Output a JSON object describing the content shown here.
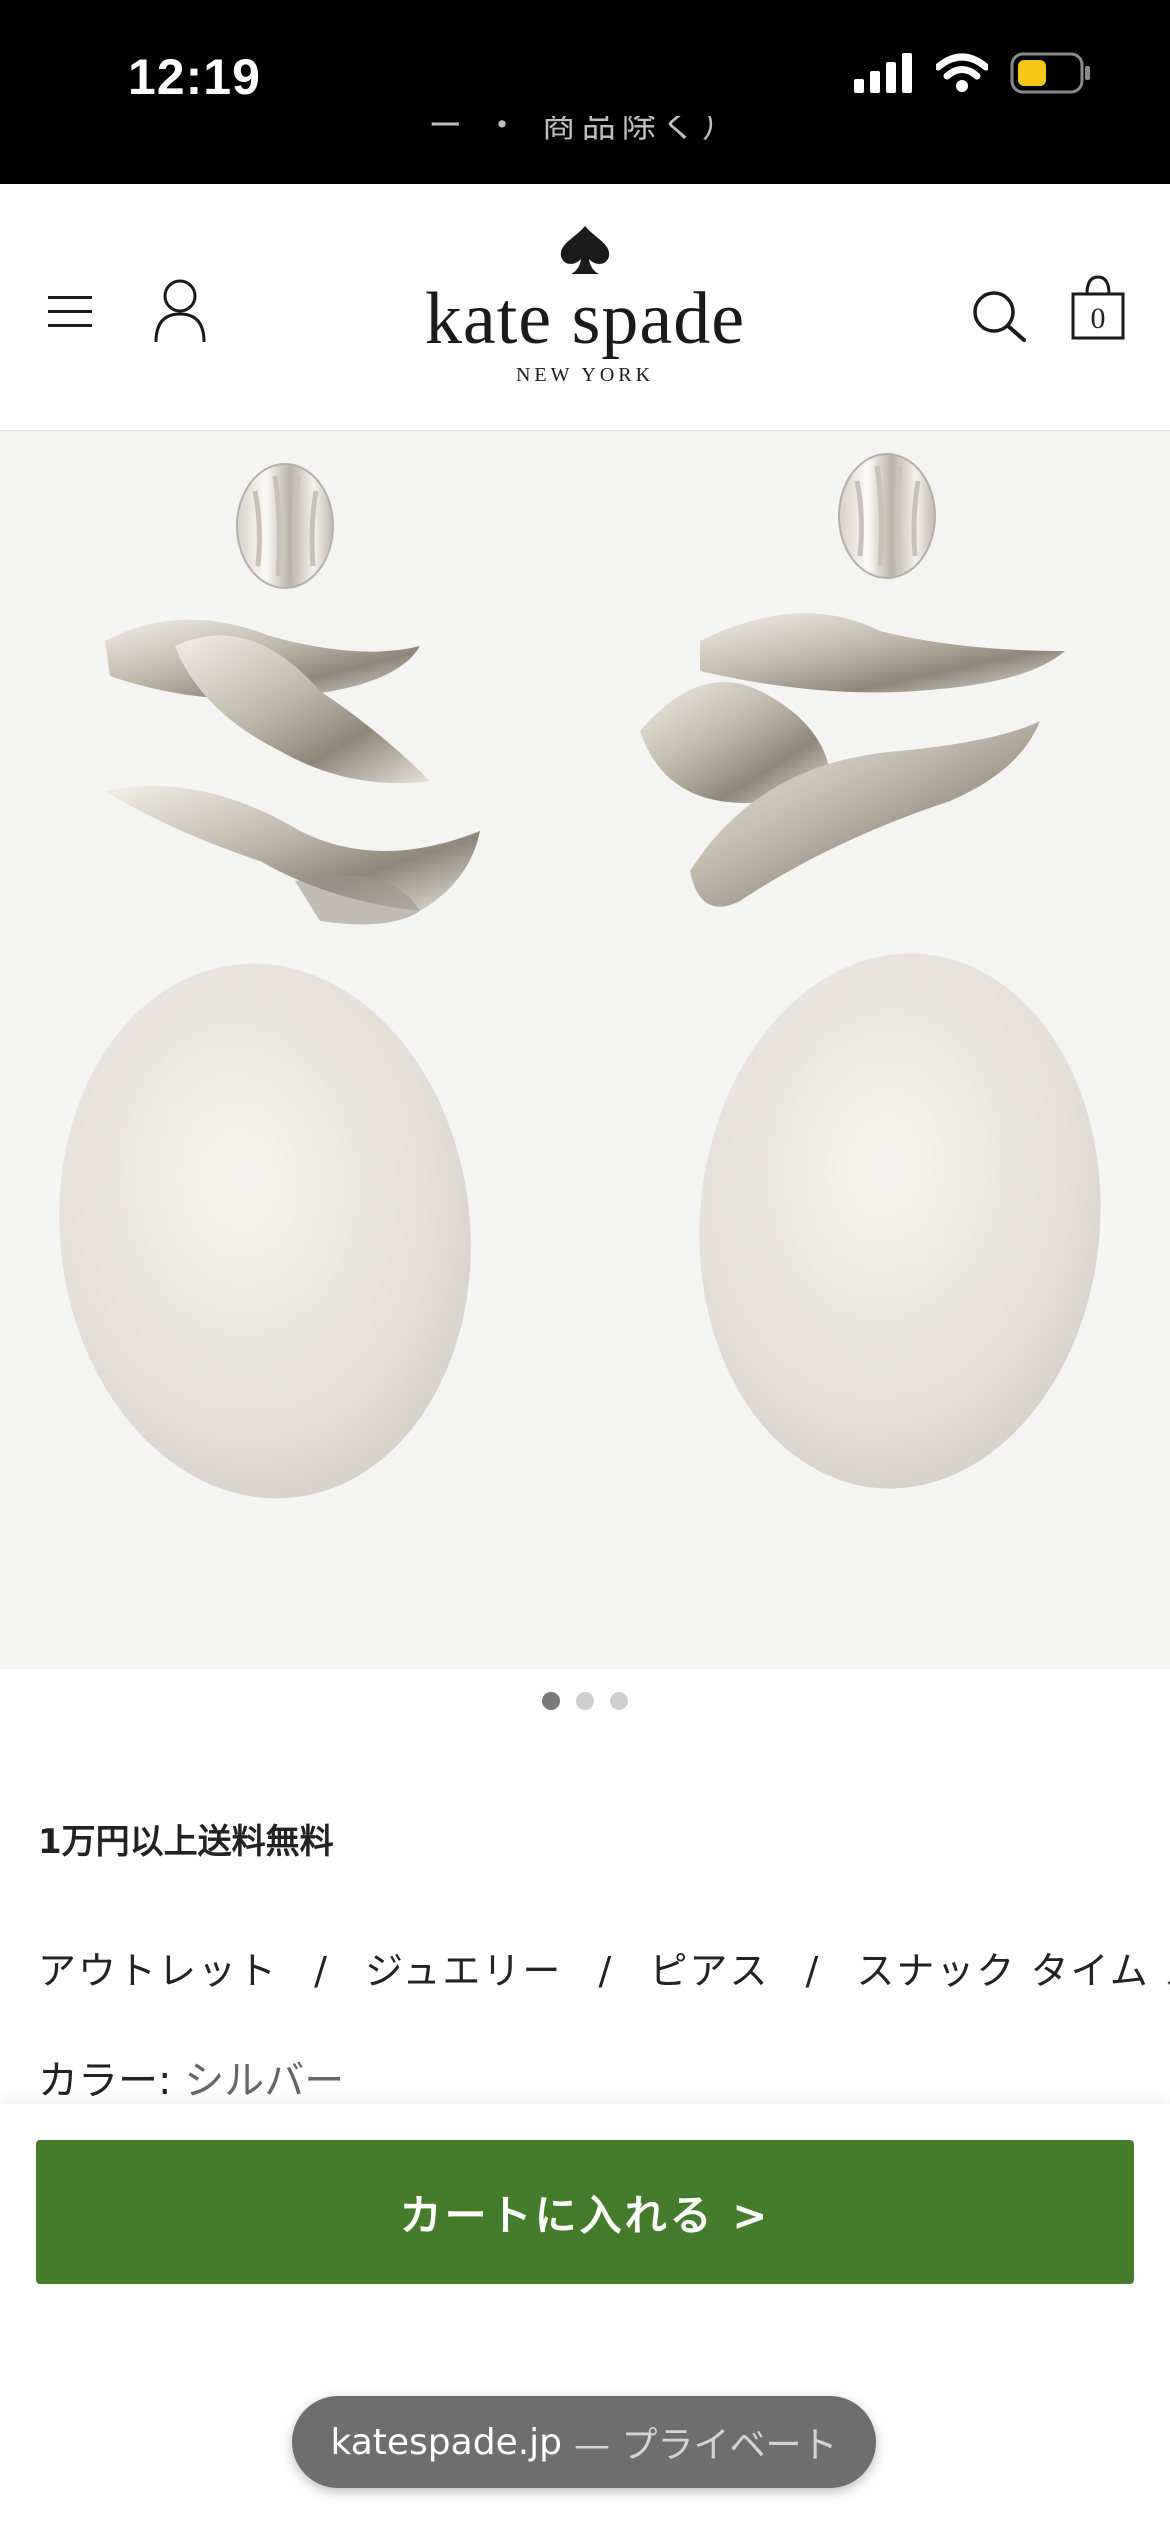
{
  "status_bar": {
    "time": "12:19",
    "icons": [
      "signal-icon",
      "wifi-icon",
      "battery-icon"
    ],
    "battery_color": "#f5c518"
  },
  "scrolled_banner": {
    "text": "ー ・ 商品除く）"
  },
  "header": {
    "logo_word": "kate spade",
    "logo_sub": "NEW YORK",
    "cart_count": "0",
    "icons": [
      "menu-icon",
      "account-icon",
      "spade-icon",
      "search-icon",
      "bag-icon"
    ]
  },
  "product": {
    "image_alt": "earrings-image",
    "carousel": {
      "total": 3,
      "active": 1
    }
  },
  "info": {
    "shipping_note": "1万円以上送料無料",
    "breadcrumb": [
      "アウトレット",
      "ジュエリー",
      "ピアス",
      "スナック タイム ステート"
    ],
    "breadcrumb_sep": "/",
    "color_label": "カラー:",
    "color_value": "シルバー"
  },
  "cta": {
    "add_to_cart": "カートに入れる >"
  },
  "browser": {
    "domain": "katespade.jp",
    "mode": "— プライベート"
  },
  "colors": {
    "cta_green": "#447c2c",
    "header_black": "#000000"
  }
}
